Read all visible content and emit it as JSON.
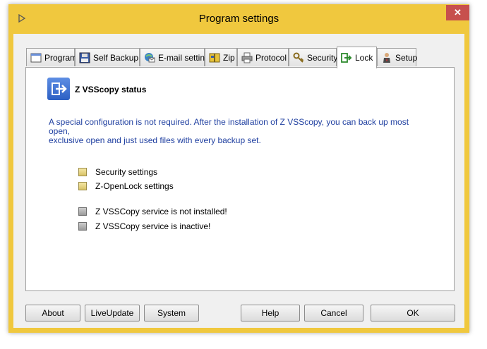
{
  "window": {
    "title": "Program settings",
    "close_label": "✕"
  },
  "tabs": [
    {
      "label": "Program",
      "icon": "program-icon"
    },
    {
      "label": "Self Backup",
      "icon": "floppy-icon"
    },
    {
      "label": "E-mail setting",
      "icon": "email-icon"
    },
    {
      "label": "Zip",
      "icon": "zip-icon"
    },
    {
      "label": "Protocol",
      "icon": "printer-icon"
    },
    {
      "label": "Security",
      "icon": "key-icon"
    },
    {
      "label": "Lock",
      "icon": "lock-arrow-icon",
      "active": true
    },
    {
      "label": "Setup",
      "icon": "user-icon"
    }
  ],
  "panel": {
    "title": "Z VSScopy status",
    "info_line1": "A special configuration is not required. After the installation of Z VSScopy, you can back up most open,",
    "info_line2": "exclusive open and just used files with every backup set.",
    "items": [
      {
        "label": "Security settings",
        "color": "yellow"
      },
      {
        "label": "Z-OpenLock settings",
        "color": "yellow"
      },
      {
        "label": "Z VSSCopy service is not installed!",
        "color": "gray"
      },
      {
        "label": "Z VSSCopy service is inactive!",
        "color": "gray"
      }
    ]
  },
  "buttons": {
    "about": "About",
    "liveupdate": "LiveUpdate",
    "system": "System",
    "help": "Help",
    "cancel": "Cancel",
    "ok": "OK"
  },
  "colors": {
    "frame": "#f0c83e",
    "info_text": "#1f3fa0",
    "status_icon": "#3a6fd4"
  }
}
